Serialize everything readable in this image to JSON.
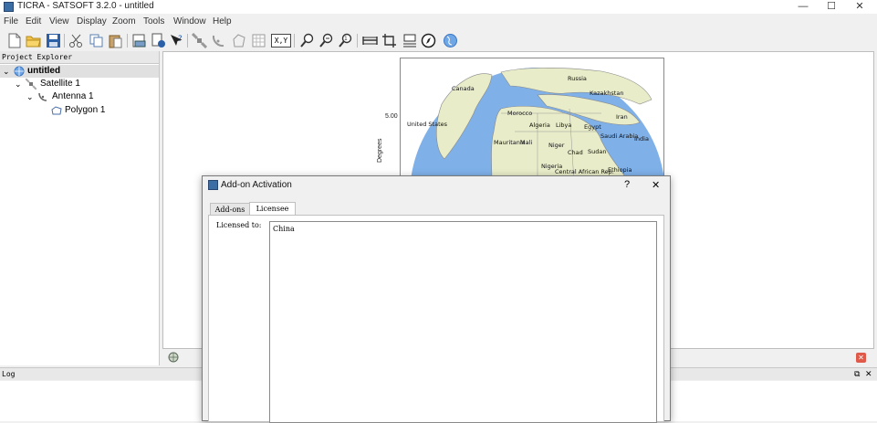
{
  "window": {
    "title": "TICRA - SATSOFT 3.2.0 - untitled",
    "controls": {
      "minimize": "—",
      "maximize": "☐",
      "close": "✕"
    }
  },
  "menu": [
    "File",
    "Edit",
    "View",
    "Display",
    "Zoom",
    "Tools",
    "Window",
    "Help"
  ],
  "toolbar": {
    "icons": [
      "new-file-icon",
      "open-folder-icon",
      "save-icon",
      "cut-icon",
      "copy-icon",
      "paste-icon",
      "print-preview-icon",
      "document-info-icon",
      "whats-this-icon",
      "satellite-icon",
      "antenna-icon",
      "polygon-icon",
      "grid-icon",
      "xy-coordinates-icon",
      "zoom-in-icon",
      "zoom-out-icon",
      "zoom-reset-icon",
      "fit-width-icon",
      "crop-icon",
      "scale-icon",
      "compass-icon",
      "globe-icon"
    ],
    "xy_label": "X,Y"
  },
  "project_explorer": {
    "title": "Project Explorer",
    "items": [
      {
        "label": "untitled",
        "level": 0,
        "icon": "globe-icon"
      },
      {
        "label": "Satellite 1",
        "level": 1,
        "icon": "satellite-icon"
      },
      {
        "label": "Antenna 1",
        "level": 2,
        "icon": "antenna-icon"
      },
      {
        "label": "Polygon 1",
        "level": 3,
        "icon": "polygon-icon"
      }
    ]
  },
  "plot": {
    "y_tick": "5.00",
    "y_axis_label": "Degrees",
    "countries": [
      "Russia",
      "Canada",
      "Kazakhstan",
      "United States",
      "Morocco",
      "Iran",
      "Algeria",
      "Libya",
      "Egypt",
      "Saudi Arabia",
      "India",
      "Mauritania",
      "Mali",
      "Niger",
      "Chad",
      "Sudan",
      "Nigeria",
      "Central African Rep.",
      "Ethiopia"
    ]
  },
  "log": {
    "title": "Log"
  },
  "dialog": {
    "title": "Add-on Activation",
    "help": "?",
    "close": "✕",
    "tabs": [
      "Add-ons",
      "Licensee"
    ],
    "active_tab": "Licensee",
    "licensed_to_label": "Licensed to:",
    "licensed_to_value": "China"
  },
  "colors": {
    "ocean": "#7fb0e8",
    "land": "#e8ecc8",
    "close_red": "#e05a4a"
  }
}
